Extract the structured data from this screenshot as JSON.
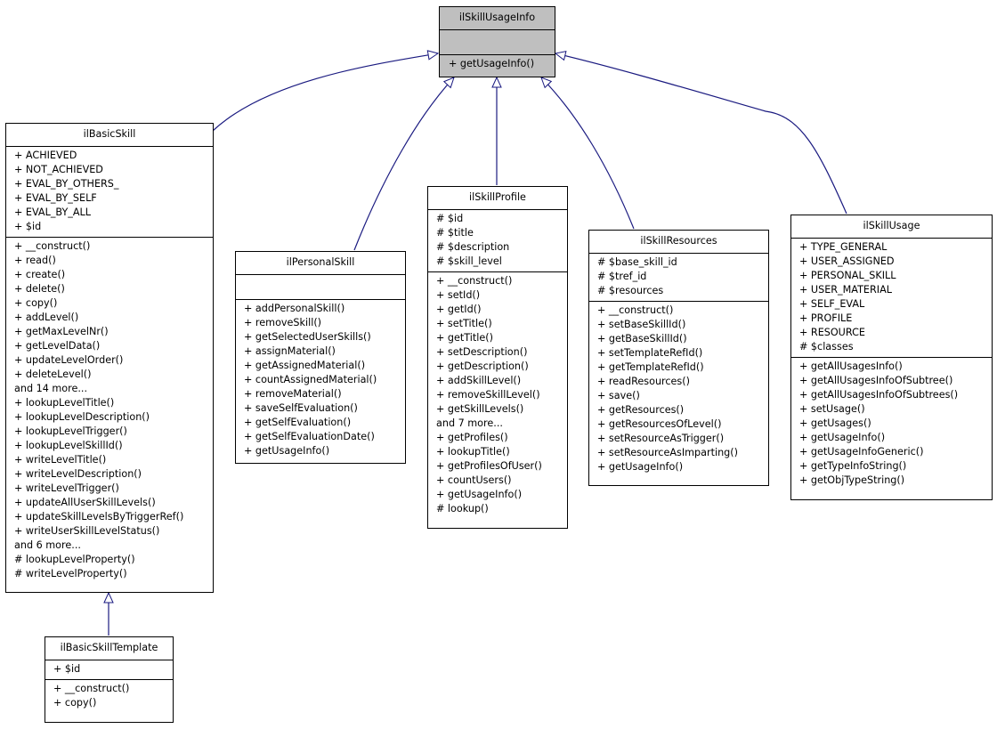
{
  "diagram": {
    "type": "UML class inheritance diagram",
    "edge_color": "#1a1a80",
    "base_fill": "#bfbfbf",
    "classes": {
      "base": {
        "name": "ilSkillUsageInfo",
        "attributes": [],
        "methods": [
          "+ getUsageInfo()"
        ]
      },
      "basic_skill": {
        "name": "ilBasicSkill",
        "attributes": [
          "+ ACHIEVED",
          "+ NOT_ACHIEVED",
          "+ EVAL_BY_OTHERS_",
          "+ EVAL_BY_SELF",
          "+ EVAL_BY_ALL",
          "+ $id"
        ],
        "methods": [
          "+ __construct()",
          "+ read()",
          "+ create()",
          "+ delete()",
          "+ copy()",
          "+ addLevel()",
          "+ getMaxLevelNr()",
          "+ getLevelData()",
          "+ updateLevelOrder()",
          "+ deleteLevel()",
          "and 14 more...",
          "+ lookupLevelTitle()",
          "+ lookupLevelDescription()",
          "+ lookupLevelTrigger()",
          "+ lookupLevelSkillId()",
          "+ writeLevelTitle()",
          "+ writeLevelDescription()",
          "+ writeLevelTrigger()",
          "+ updateAllUserSkillLevels()",
          "+ updateSkillLevelsByTriggerRef()",
          "+ writeUserSkillLevelStatus()",
          "and 6 more...",
          "# lookupLevelProperty()",
          "# writeLevelProperty()"
        ]
      },
      "basic_skill_template": {
        "name": "ilBasicSkillTemplate",
        "attributes": [
          "+ $id"
        ],
        "methods": [
          "+ __construct()",
          "+ copy()"
        ]
      },
      "personal_skill": {
        "name": "ilPersonalSkill",
        "attributes": [],
        "methods": [
          "+ addPersonalSkill()",
          "+ removeSkill()",
          "+ getSelectedUserSkills()",
          "+ assignMaterial()",
          "+ getAssignedMaterial()",
          "+ countAssignedMaterial()",
          "+ removeMaterial()",
          "+ saveSelfEvaluation()",
          "+ getSelfEvaluation()",
          "+ getSelfEvaluationDate()",
          "+ getUsageInfo()"
        ]
      },
      "skill_profile": {
        "name": "ilSkillProfile",
        "attributes": [
          "# $id",
          "# $title",
          "# $description",
          "# $skill_level"
        ],
        "methods": [
          "+ __construct()",
          "+ setId()",
          "+ getId()",
          "+ setTitle()",
          "+ getTitle()",
          "+ setDescription()",
          "+ getDescription()",
          "+ addSkillLevel()",
          "+ removeSkillLevel()",
          "+ getSkillLevels()",
          "and 7 more...",
          "+ getProfiles()",
          "+ lookupTitle()",
          "+ getProfilesOfUser()",
          "+ countUsers()",
          "+ getUsageInfo()",
          "# lookup()"
        ]
      },
      "skill_resources": {
        "name": "ilSkillResources",
        "attributes": [
          "# $base_skill_id",
          "# $tref_id",
          "# $resources"
        ],
        "methods": [
          "+ __construct()",
          "+ setBaseSkillId()",
          "+ getBaseSkillId()",
          "+ setTemplateRefId()",
          "+ getTemplateRefId()",
          "+ readResources()",
          "+ save()",
          "+ getResources()",
          "+ getResourcesOfLevel()",
          "+ setResourceAsTrigger()",
          "+ setResourceAsImparting()",
          "+ getUsageInfo()"
        ]
      },
      "skill_usage": {
        "name": "ilSkillUsage",
        "attributes": [
          "+ TYPE_GENERAL",
          "+ USER_ASSIGNED",
          "+ PERSONAL_SKILL",
          "+ USER_MATERIAL",
          "+ SELF_EVAL",
          "+ PROFILE",
          "+ RESOURCE",
          "# $classes"
        ],
        "methods": [
          "+ getAllUsagesInfo()",
          "+ getAllUsagesInfoOfSubtree()",
          "+ getAllUsagesInfoOfSubtrees()",
          "+ setUsage()",
          "+ getUsages()",
          "+ getUsageInfo()",
          "+ getUsageInfoGeneric()",
          "+ getTypeInfoString()",
          "+ getObjTypeString()"
        ]
      }
    },
    "inheritance": [
      {
        "child": "ilBasicSkill",
        "parent": "ilSkillUsageInfo"
      },
      {
        "child": "ilPersonalSkill",
        "parent": "ilSkillUsageInfo"
      },
      {
        "child": "ilSkillProfile",
        "parent": "ilSkillUsageInfo"
      },
      {
        "child": "ilSkillResources",
        "parent": "ilSkillUsageInfo"
      },
      {
        "child": "ilSkillUsage",
        "parent": "ilSkillUsageInfo"
      },
      {
        "child": "ilBasicSkillTemplate",
        "parent": "ilBasicSkill"
      }
    ]
  }
}
